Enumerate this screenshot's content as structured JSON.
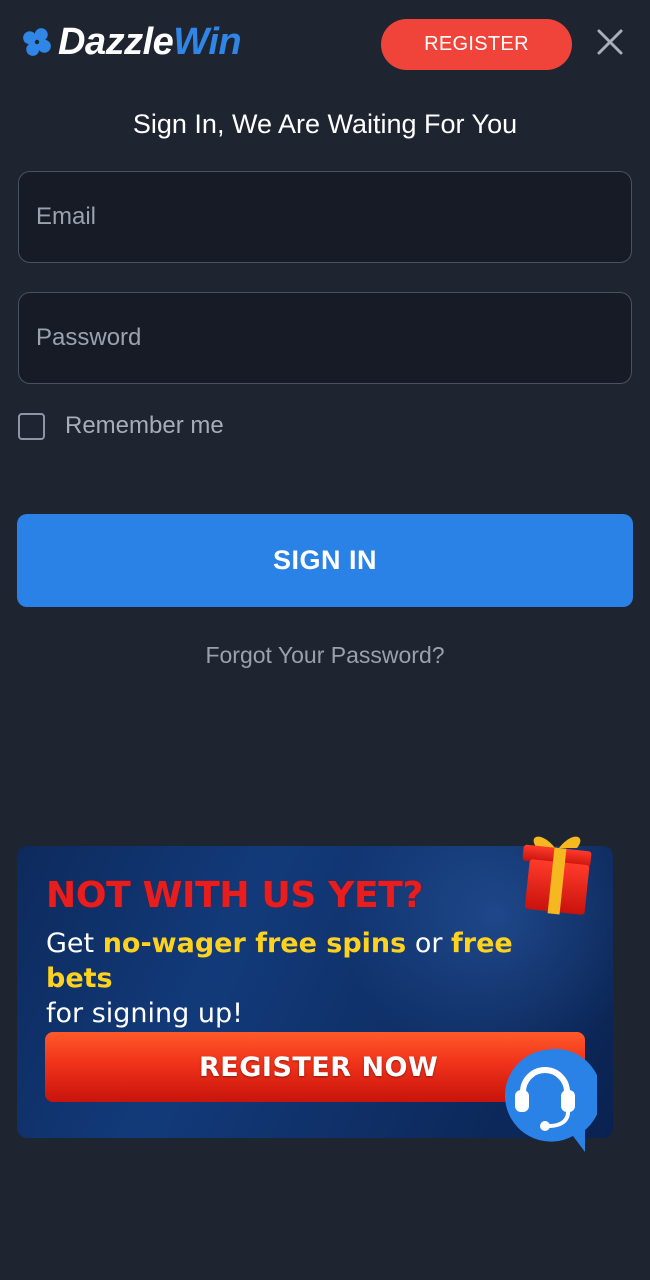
{
  "header": {
    "logo_part1": "Dazzle",
    "logo_part2": "Win",
    "register_label": "REGISTER"
  },
  "signin": {
    "title": "Sign In, We Are Waiting For You",
    "email_placeholder": "Email",
    "email_value": "",
    "password_placeholder": "Password",
    "password_value": "",
    "remember_label": "Remember me",
    "remember_checked": false,
    "button_label": "SIGN IN",
    "forgot_label": "Forgot Your Password?"
  },
  "promo": {
    "title": "NOT WITH US YET?",
    "text_1": "Get ",
    "highlight_1": "no-wager free spins",
    "text_2": " or ",
    "highlight_2": "free bets",
    "text_3": "for signing up!",
    "button_label": "REGISTER NOW"
  },
  "colors": {
    "background": "#1e2430",
    "accent_blue": "#2b82e6",
    "register_red": "#f0443a",
    "promo_title_red": "#e81e1e",
    "promo_highlight": "#ffd21f"
  },
  "icons": {
    "logo": "clover-icon",
    "close": "close-icon",
    "gift": "gift-icon",
    "support": "headset-chat-icon"
  }
}
